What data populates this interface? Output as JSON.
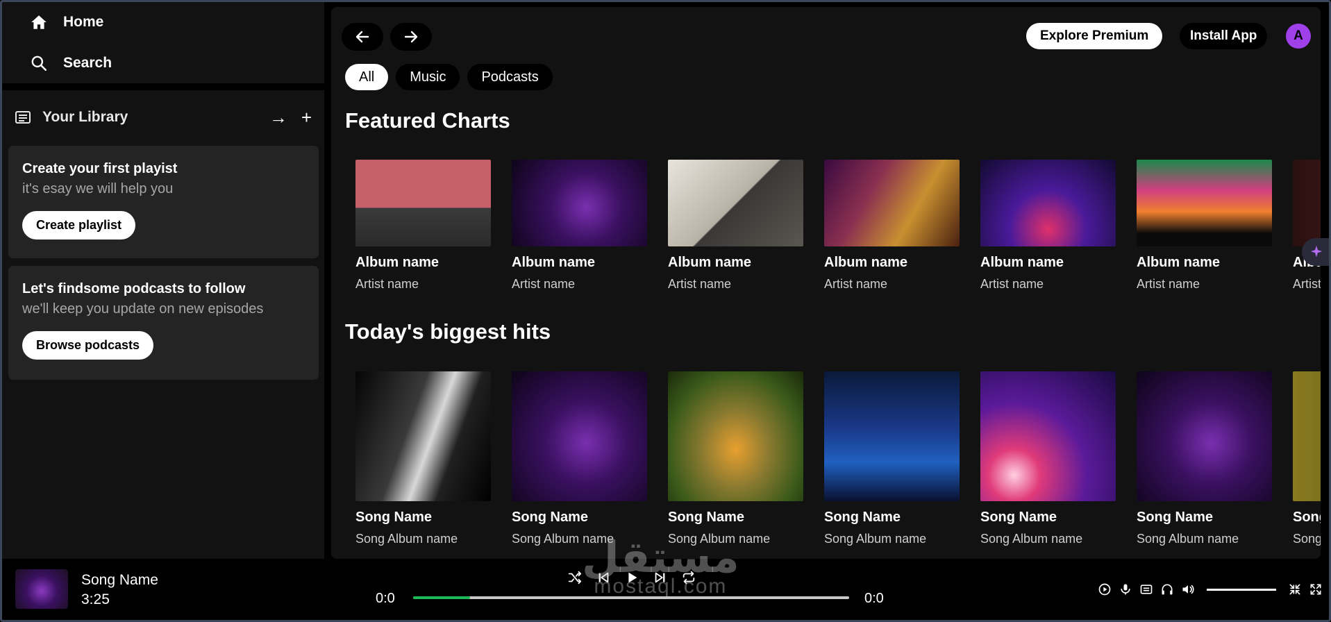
{
  "sidebar": {
    "home_label": "Home",
    "search_label": "Search",
    "library_title": "Your Library",
    "cards": [
      {
        "title": "Create your first playist",
        "text": "it's esay we will help you",
        "button": "Create playlist"
      },
      {
        "title": "Let's findsome podcasts to follow",
        "text": "we'll keep you update on new episodes",
        "button": "Browse podcasts"
      }
    ]
  },
  "header": {
    "premium_label": "Explore Premium",
    "install_label": "Install App",
    "avatar_letter": "A",
    "chips": [
      "All",
      "Music",
      "Podcasts"
    ]
  },
  "sections": [
    {
      "title": "Featured Charts",
      "items": [
        {
          "title": "Album name",
          "subtitle": "Artist name"
        },
        {
          "title": "Album name",
          "subtitle": "Artist name"
        },
        {
          "title": "Album name",
          "subtitle": "Artist name"
        },
        {
          "title": "Album name",
          "subtitle": "Artist name"
        },
        {
          "title": "Album name",
          "subtitle": "Artist name"
        },
        {
          "title": "Album name",
          "subtitle": "Artist name"
        },
        {
          "title": "Album name",
          "subtitle": "Artist name"
        }
      ]
    },
    {
      "title": "Today's biggest hits",
      "items": [
        {
          "title": "Song Name",
          "subtitle": "Song Album name"
        },
        {
          "title": "Song Name",
          "subtitle": "Song Album name"
        },
        {
          "title": "Song Name",
          "subtitle": "Song Album name"
        },
        {
          "title": "Song Name",
          "subtitle": "Song Album name"
        },
        {
          "title": "Song Name",
          "subtitle": "Song Album name"
        },
        {
          "title": "Song Name",
          "subtitle": "Song Album name"
        },
        {
          "title": "Song Name",
          "subtitle": "Song Album name"
        }
      ]
    }
  ],
  "player": {
    "song_name": "Song Name",
    "duration": "3:25",
    "current_time": "0:0",
    "total_time": "0:0",
    "progress": 0.13,
    "volume": 1.0
  },
  "watermark": {
    "arabic": "مستقل",
    "latin": "mostaql.com"
  },
  "colors": {
    "accent": "#1db954",
    "avatar": "#a040e8",
    "panel": "#121212",
    "card": "#242424"
  }
}
